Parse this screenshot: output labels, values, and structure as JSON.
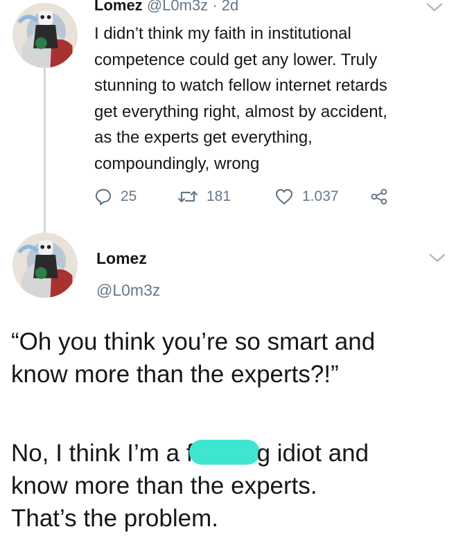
{
  "tweet1": {
    "author_name": "Lomez",
    "author_handle": "@L0m3z",
    "separator": "·",
    "time": "2d",
    "text_lines": [
      "I didn’t think my faith in institutional",
      "competence could get any lower. Truly",
      "stunning to watch fellow internet retards",
      "get everything right, almost by accident,",
      "as the experts get everything,",
      "compoundingly, wrong"
    ],
    "actions": {
      "replies": "25",
      "retweets": "181",
      "likes": "1.037"
    },
    "icons": [
      "reply-icon",
      "retweet-icon",
      "like-icon",
      "share-icon",
      "chevron-down-icon"
    ]
  },
  "tweet2": {
    "author_name": "Lomez",
    "author_handle": "@L0m3z",
    "text": {
      "quote_lines": [
        "“Oh you think you’re so smart and",
        "know more than the experts?!”"
      ],
      "reply_line1_before": "No, I think I’m a f",
      "reply_line1_after": "g idiot and",
      "reply_lines": [
        "know more than the experts.",
        "That’s the problem."
      ]
    }
  },
  "colors": {
    "text": "#14171a",
    "secondary_text": "#657786",
    "thread_line": "#cfd9de",
    "censor_mark": "#3ee6d2"
  }
}
